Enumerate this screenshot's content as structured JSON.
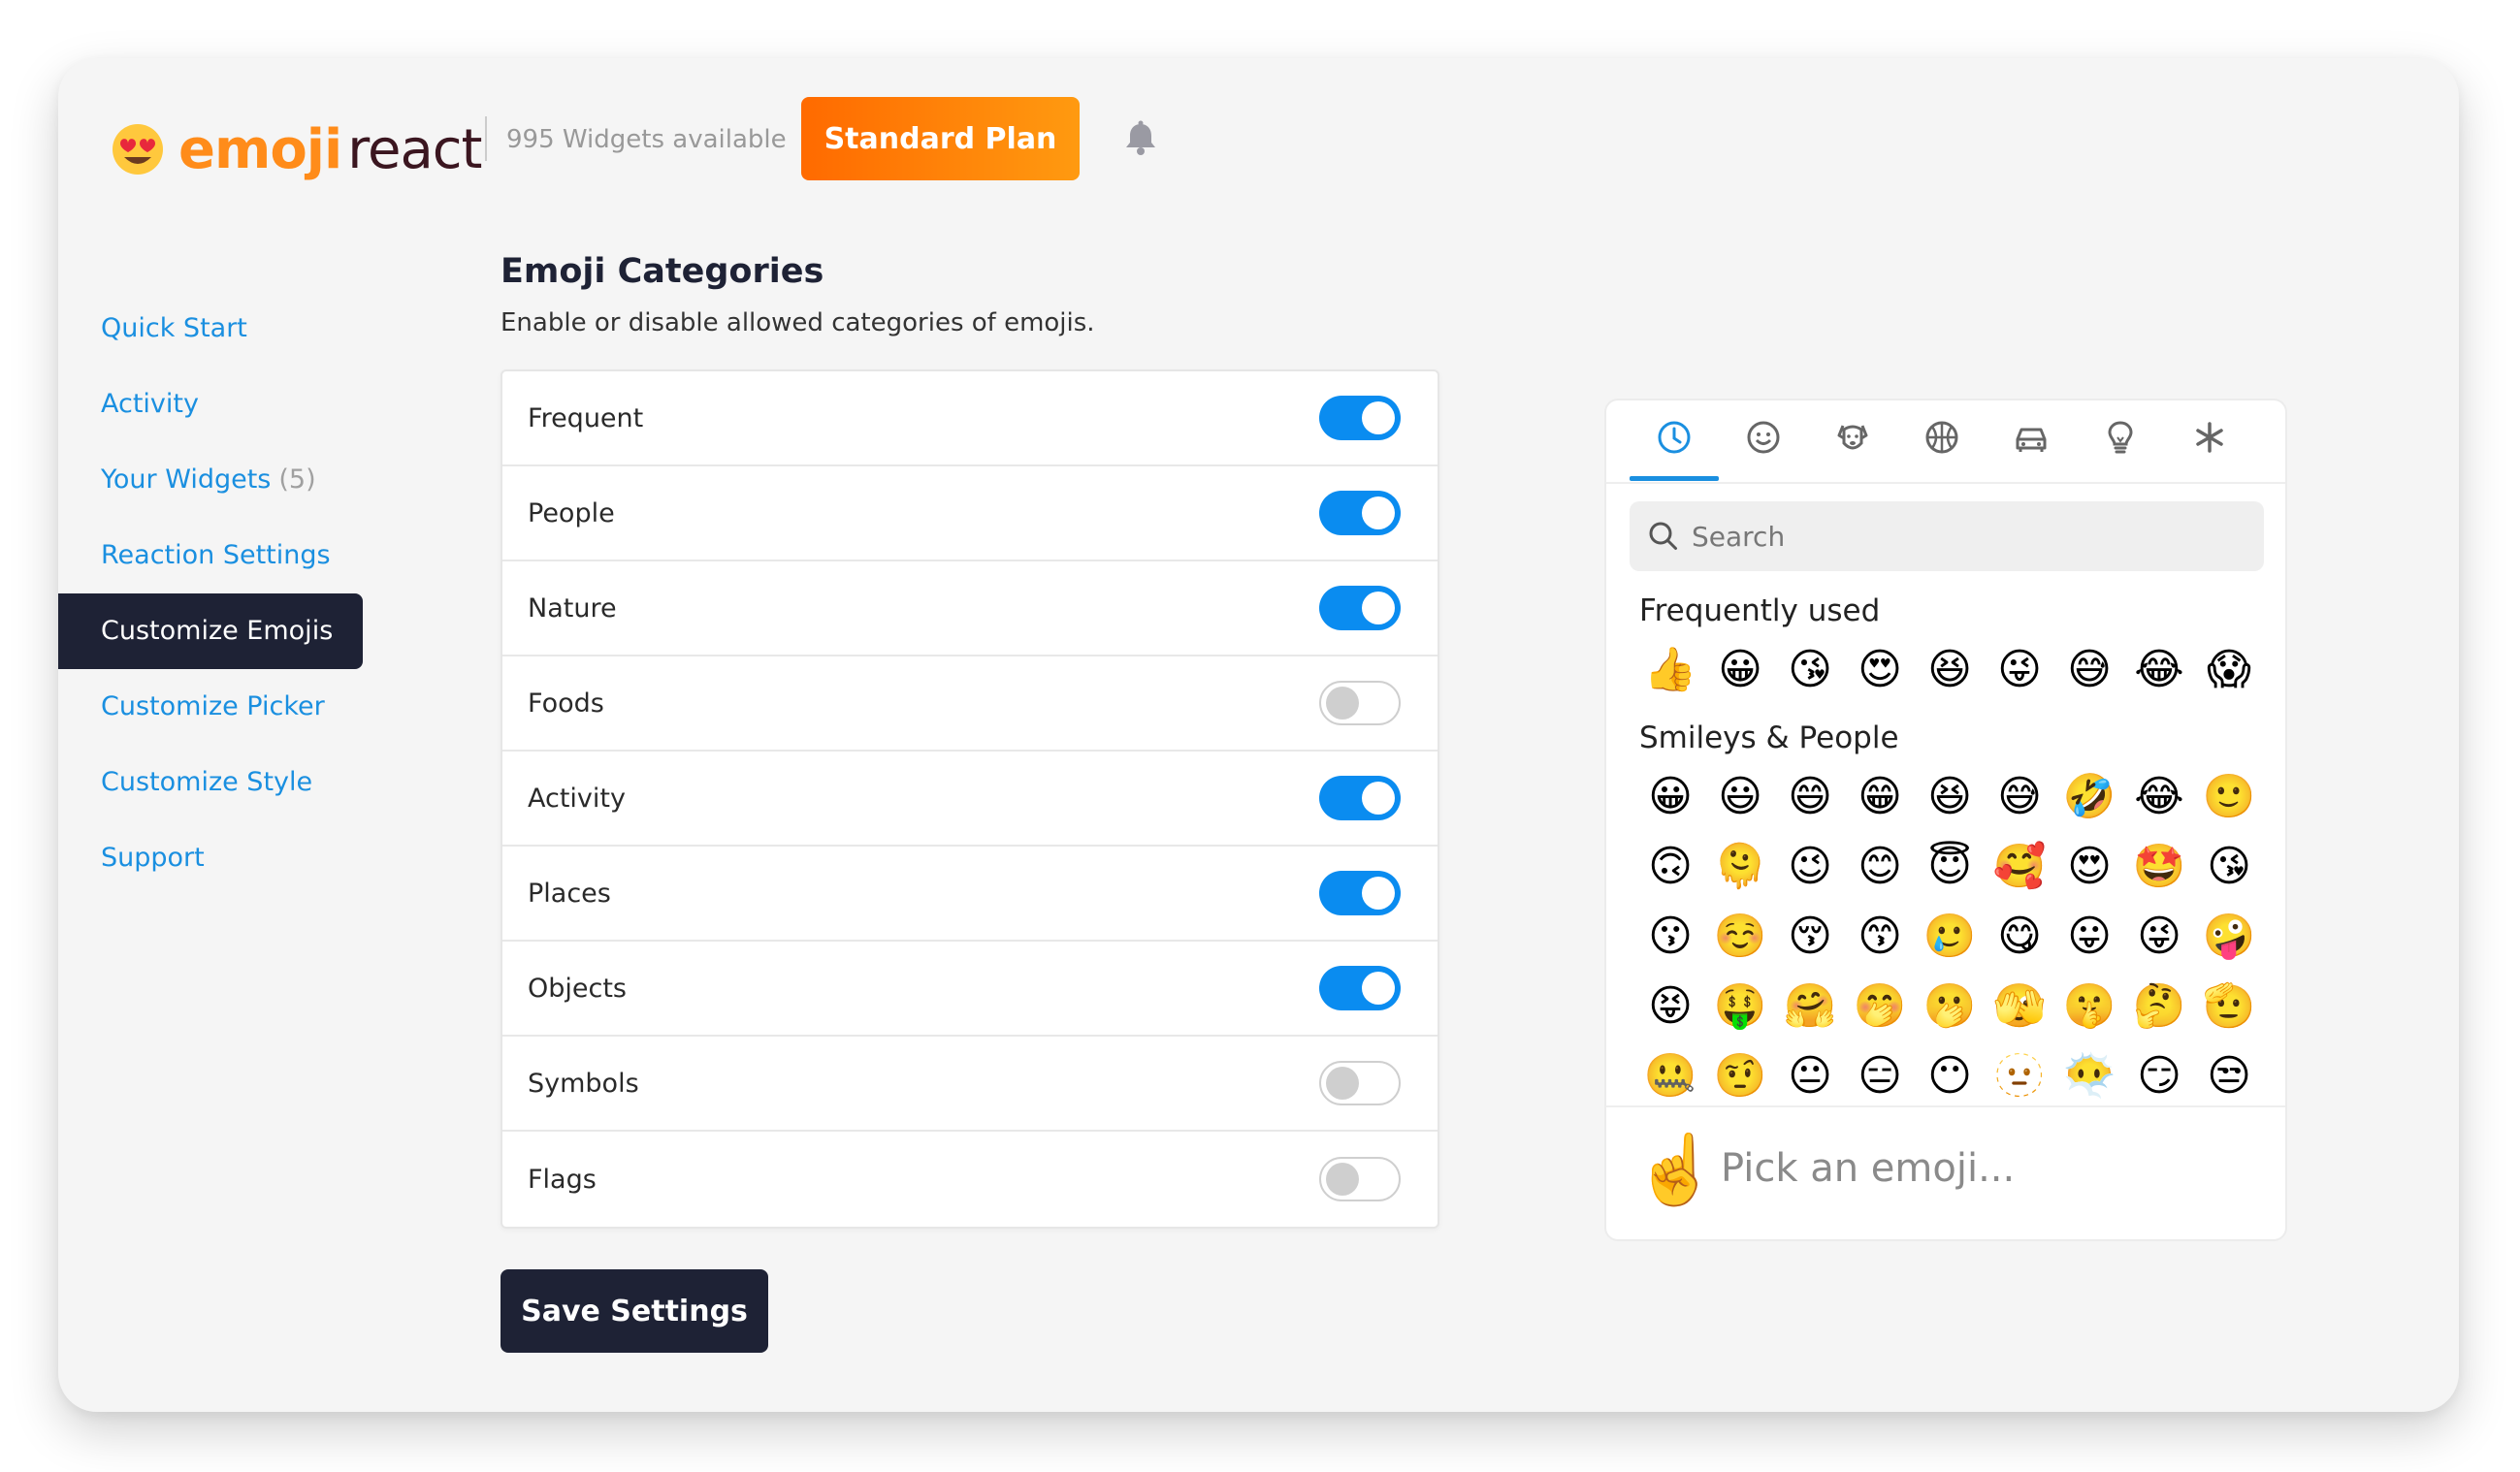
{
  "header": {
    "logo_part1": "emoji",
    "logo_part2": "react",
    "widgets_available": "995 Widgets available",
    "plan_button": "Standard Plan"
  },
  "sidebar": {
    "items": [
      {
        "label": "Quick Start"
      },
      {
        "label": "Activity"
      },
      {
        "label": "Your Widgets",
        "count": "(5)"
      },
      {
        "label": "Reaction Settings"
      },
      {
        "label": "Customize Emojis",
        "active": true
      },
      {
        "label": "Customize Picker"
      },
      {
        "label": "Customize Style"
      },
      {
        "label": "Support"
      }
    ]
  },
  "main": {
    "title": "Emoji Categories",
    "description": "Enable or disable allowed categories of emojis.",
    "categories": [
      {
        "label": "Frequent",
        "enabled": true
      },
      {
        "label": "People",
        "enabled": true
      },
      {
        "label": "Nature",
        "enabled": true
      },
      {
        "label": "Foods",
        "enabled": false
      },
      {
        "label": "Activity",
        "enabled": true
      },
      {
        "label": "Places",
        "enabled": true
      },
      {
        "label": "Objects",
        "enabled": true
      },
      {
        "label": "Symbols",
        "enabled": false
      },
      {
        "label": "Flags",
        "enabled": false
      }
    ],
    "save_button": "Save Settings"
  },
  "picker": {
    "tabs": [
      "clock-icon",
      "smiley-icon",
      "dog-icon",
      "ball-icon",
      "car-icon",
      "bulb-icon",
      "asterisk-icon"
    ],
    "search_placeholder": "Search",
    "frequent_title": "Frequently used",
    "frequent": [
      "👍",
      "😀",
      "😘",
      "😍",
      "😆",
      "😜",
      "😅",
      "😂",
      "😱"
    ],
    "smileys_title": "Smileys & People",
    "smileys": [
      [
        "😀",
        "😃",
        "😄",
        "😁",
        "😆",
        "😅",
        "🤣",
        "😂",
        "🙂"
      ],
      [
        "🙃",
        "🫠",
        "😉",
        "😊",
        "😇",
        "🥰",
        "😍",
        "🤩",
        "😘"
      ],
      [
        "😗",
        "☺️",
        "😚",
        "😙",
        "🥲",
        "😋",
        "😛",
        "😜",
        "🤪"
      ],
      [
        "😝",
        "🤑",
        "🤗",
        "🤭",
        "🫢",
        "🫣",
        "🤫",
        "🤔",
        "🫡"
      ],
      [
        "🤐",
        "🤨",
        "😐",
        "😑",
        "😶",
        "🫥",
        "😶‍🌫️",
        "😏",
        "😒"
      ]
    ],
    "footer_emoji": "☝️",
    "footer_text": "Pick an emoji..."
  },
  "colors": {
    "accent_blue": "#0a8cf0",
    "nav_active_bg": "#1e2235",
    "plan_gradient_start": "#ff6a00",
    "plan_gradient_end": "#ff9a10"
  }
}
